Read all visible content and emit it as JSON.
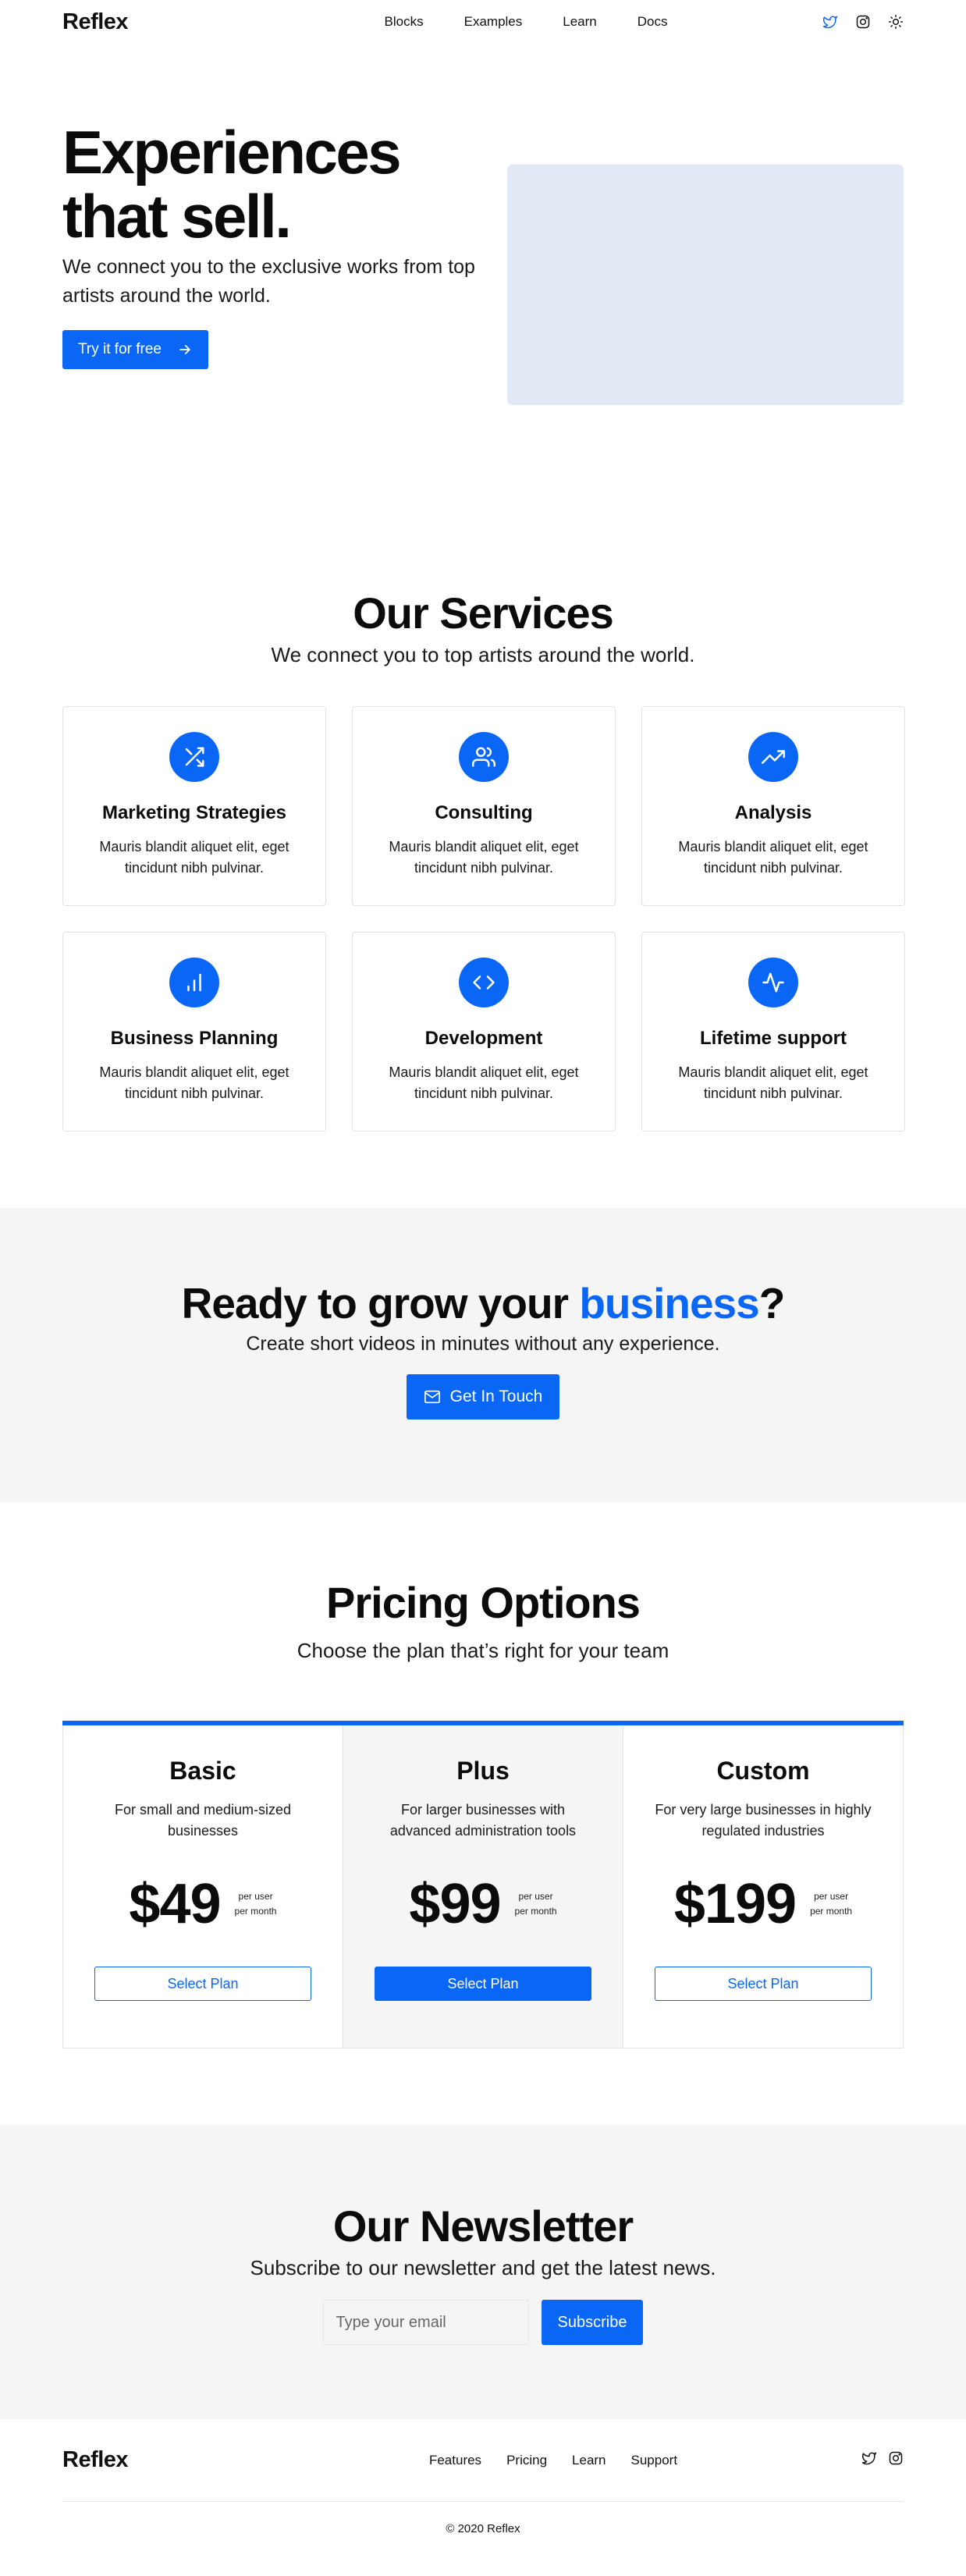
{
  "nav": {
    "brand": "Reflex",
    "links": [
      "Blocks",
      "Examples",
      "Learn",
      "Docs"
    ],
    "icons": [
      "twitter-icon",
      "instagram-icon",
      "sun-icon"
    ],
    "accent": "#0a66f5"
  },
  "hero": {
    "title_line1": "Experiences",
    "title_line2": "that sell.",
    "subtitle": "We connect you to the exclusive works from top artists around the world.",
    "cta_label": "Try it for free"
  },
  "services": {
    "title": "Our Services",
    "subtitle": "We connect you to top artists around the world.",
    "items": [
      {
        "title": "Marketing Strategies",
        "text": "Mauris blandit aliquet elit, eget tincidunt nibh pulvinar.",
        "icon": "shuffle-icon"
      },
      {
        "title": "Consulting",
        "text": "Mauris blandit aliquet elit, eget tincidunt nibh pulvinar.",
        "icon": "users-icon"
      },
      {
        "title": "Analysis",
        "text": "Mauris blandit aliquet elit, eget tincidunt nibh pulvinar.",
        "icon": "trending-up-icon"
      },
      {
        "title": "Business Planning",
        "text": "Mauris blandit aliquet elit, eget tincidunt nibh pulvinar.",
        "icon": "bar-chart-icon"
      },
      {
        "title": "Development",
        "text": "Mauris blandit aliquet elit, eget tincidunt nibh pulvinar.",
        "icon": "code-icon"
      },
      {
        "title": "Lifetime support",
        "text": "Mauris blandit aliquet elit, eget tincidunt nibh pulvinar.",
        "icon": "activity-icon"
      }
    ]
  },
  "cta": {
    "title_before": "Ready to grow your ",
    "title_accent": "business",
    "title_after": "?",
    "subtitle": "Create short videos in minutes without any experience.",
    "button_label": "Get In Touch"
  },
  "pricing": {
    "title": "Pricing Options",
    "subtitle": "Choose the plan that’s right for your team",
    "per_line1": "per user",
    "per_line2": "per month",
    "plans": [
      {
        "name": "Basic",
        "description": "For small and medium-sized businesses",
        "price": "$49",
        "button": "Select Plan"
      },
      {
        "name": "Plus",
        "description": "For larger businesses with advanced administration tools",
        "price": "$99",
        "button": "Select Plan"
      },
      {
        "name": "Custom",
        "description": "For very large businesses in highly regulated industries",
        "price": "$199",
        "button": "Select Plan"
      }
    ]
  },
  "newsletter": {
    "title": "Our Newsletter",
    "subtitle": "Subscribe to our newsletter and get the latest news.",
    "email_placeholder": "Type your email",
    "email_value": "",
    "button_label": "Subscribe"
  },
  "footer": {
    "brand": "Reflex",
    "links": [
      "Features",
      "Pricing",
      "Learn",
      "Support"
    ],
    "copyright": "© 2020 Reflex"
  }
}
